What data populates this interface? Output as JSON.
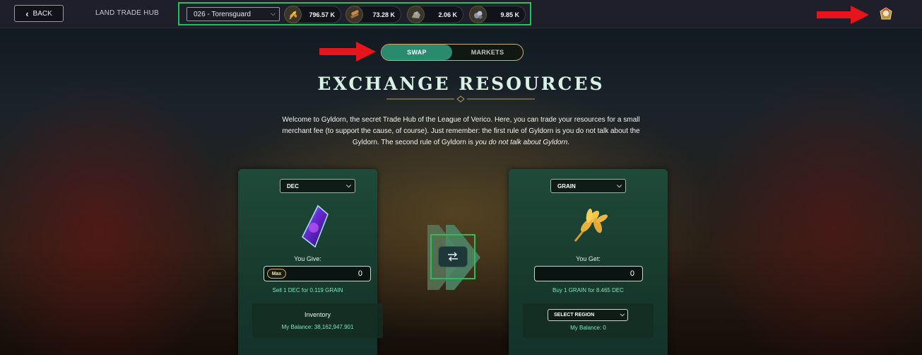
{
  "header": {
    "back_label": "BACK",
    "title": "LAND TRADE HUB",
    "region_selected": "026 - Torensguard",
    "resources": [
      {
        "name": "grain",
        "icon": "grain-icon",
        "value": "796.57 K"
      },
      {
        "name": "wood",
        "icon": "wood-icon",
        "value": "73.28 K"
      },
      {
        "name": "stone",
        "icon": "stone-icon",
        "value": "2.06 K"
      },
      {
        "name": "iron",
        "icon": "iron-icon",
        "value": "9.85 K"
      }
    ]
  },
  "tabs": {
    "swap": "SWAP",
    "markets": "MARKETS",
    "active": "swap"
  },
  "headline": "EXCHANGE RESOURCES",
  "intro": {
    "text": "Welcome to Gyldorn, the secret Trade Hub of the League of Verico. Here, you can trade your resources for a small merchant fee (to support the cause, of course). Just remember: the first rule of Gyldorn is you do not talk about the Gyldorn. The second rule of Gyldorn is ",
    "emphasis": "you do not talk about Gyldorn."
  },
  "give": {
    "currency": "DEC",
    "label": "You Give:",
    "max_label": "Max",
    "amount": "0",
    "rate": "Sell 1 DEC for 0.119 GRAIN",
    "inventory_title": "Inventory",
    "balance": "My Balance: 38,162,947.901"
  },
  "get": {
    "currency": "GRAIN",
    "label": "You Get:",
    "amount": "0",
    "rate": "Buy 1 GRAIN for 8.465 DEC",
    "region_select": "SELECT REGION",
    "balance": "My Balance: 0"
  },
  "colors": {
    "highlight": "#21c454",
    "accent_green": "#2a8a6e",
    "rate_text": "#7fe6c4",
    "gold": "#c9b071",
    "arrow_red": "#e8141b"
  }
}
